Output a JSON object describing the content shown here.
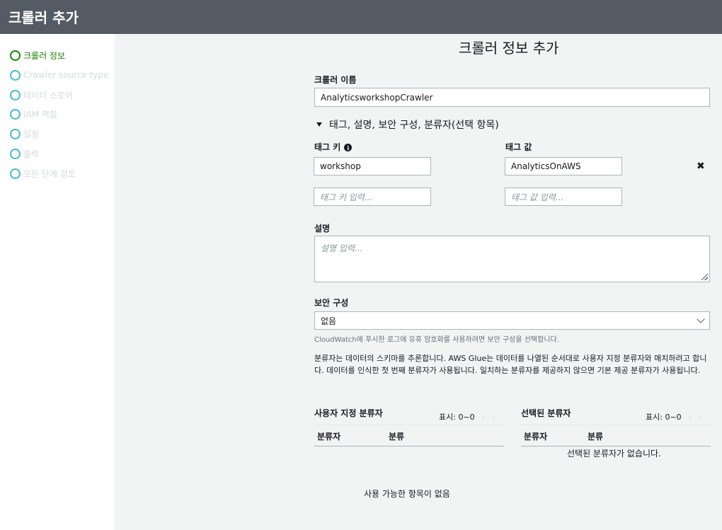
{
  "window": {
    "title": "크롤러 추가"
  },
  "steps": [
    {
      "label": "크롤러 정보",
      "active": true
    },
    {
      "label": "Crawler source type"
    },
    {
      "label": "데이터 스토어"
    },
    {
      "label": "IAM 역할"
    },
    {
      "label": "일정"
    },
    {
      "label": "출력"
    },
    {
      "label": "모든 단계 검토"
    }
  ],
  "page": {
    "heading": "크롤러 정보 추가"
  },
  "crawler_name": {
    "label": "크롤러 이름",
    "value": "AnalyticsworkshopCrawler"
  },
  "optional_section": {
    "label": "태그, 설명, 보안 구성, 분류자(선택 항목)"
  },
  "tags": {
    "key_label": "태그 키",
    "value_label": "태그 값",
    "rows": [
      {
        "key": "workshop",
        "value": "AnalyticsOnAWS"
      }
    ],
    "key_placeholder": "태그 키 입력...",
    "value_placeholder": "태그 값 입력...",
    "remove_glyph": "✖",
    "info_glyph": "i"
  },
  "description": {
    "label": "설명",
    "placeholder": "설명 입력..."
  },
  "security": {
    "label": "보안 구성",
    "value": "없음",
    "hint": "CloudWatch에 푸시한 로그에 유휴 암호화를 사용하려면 보안 구성을 선택합니다."
  },
  "classifier_info": "분류자는 데이터의 스키마를 추론합니다. AWS Glue는 데이터를 나열된 순서대로 사용자 지정 분류자와 매치하려고 합니다. 데이터를 인식한 첫 번째 분류자가 사용됩니다. 일치하는 분류자를 제공하지 않으면 기본 제공 분류자가 사용됩니다.",
  "custom_classifiers": {
    "title": "사용자 지정 분류자",
    "pager": "표시: 0~0",
    "prev": "‹",
    "next": "›",
    "columns": [
      "분류자",
      "분류"
    ],
    "empty": "사용 가능한 항목이 없음"
  },
  "selected_classifiers": {
    "title": "선택된 분류자",
    "pager": "표시: 0~0",
    "prev": "‹",
    "next": "›",
    "columns": [
      "분류자",
      "분류"
    ],
    "empty": "선택된 분류자가 없습니다."
  },
  "colors": {
    "header_bg": "#545b64",
    "active_step": "#1d8102",
    "step_circle": "#44b9d6",
    "panel_bg": "#f2f3f3"
  }
}
